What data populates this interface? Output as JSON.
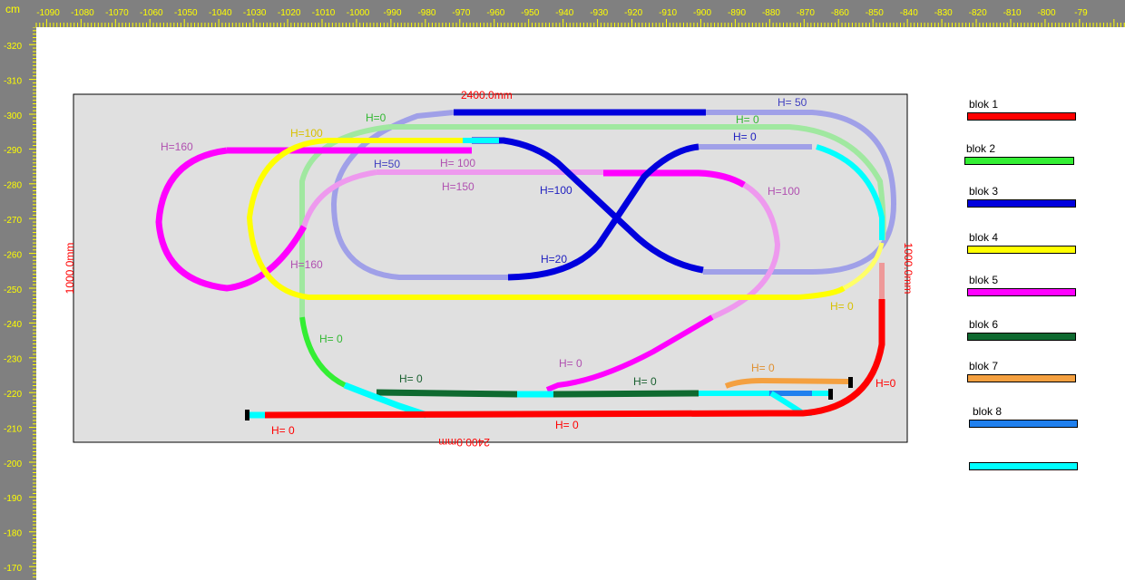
{
  "ruler": {
    "unit_label": "cm",
    "top_labels": [
      "-1090",
      "-1080",
      "-1070",
      "-1060",
      "-1050",
      "-1040",
      "-1030",
      "-1020",
      "-1010",
      "-1000",
      "-990",
      "-980",
      "-970",
      "-960",
      "-950",
      "-940",
      "-930",
      "-920",
      "-910",
      "-900",
      "-890",
      "-880",
      "-870",
      "-860",
      "-850",
      "-840",
      "-830",
      "-820",
      "-810",
      "-800",
      "-79"
    ],
    "left_labels": [
      "-320",
      "-310",
      "-300",
      "-290",
      "-280",
      "-270",
      "-260",
      "-250",
      "-240",
      "-230",
      "-220",
      "-210",
      "-200",
      "-190",
      "-180",
      "-170"
    ],
    "label_color": "#ffff00",
    "background": "#808080"
  },
  "board": {
    "width_label": "2400.0mm",
    "height_label": "1000.0mm",
    "background": "#e0e0e0",
    "dimension_color": "#ff0000"
  },
  "height_labels": [
    {
      "text": "H=0",
      "color": "#33b833"
    },
    {
      "text": "H=100",
      "color": "#d8c000"
    },
    {
      "text": "H=160",
      "color": "#b050b0"
    },
    {
      "text": "H=50",
      "color": "#4040c0"
    },
    {
      "text": "H= 100",
      "color": "#b050b0"
    },
    {
      "text": "H=150",
      "color": "#b050b0"
    },
    {
      "text": "H=100",
      "color": "#2020c0"
    },
    {
      "text": "H= 50",
      "color": "#4040c0"
    },
    {
      "text": "H= 0",
      "color": "#33b833"
    },
    {
      "text": "H= 0",
      "color": "#2020c0"
    },
    {
      "text": "H=100",
      "color": "#b050b0"
    },
    {
      "text": "H=20",
      "color": "#2020c0"
    },
    {
      "text": "H=160",
      "color": "#b050b0"
    },
    {
      "text": "H= 0",
      "color": "#d8c000"
    },
    {
      "text": "H= 0",
      "color": "#33b833"
    },
    {
      "text": "H= 0",
      "color": "#b050b0"
    },
    {
      "text": "H= 0",
      "color": "#1a6030"
    },
    {
      "text": "H= 0",
      "color": "#1a6030"
    },
    {
      "text": "H= 0",
      "color": "#e09030"
    },
    {
      "text": "H=0",
      "color": "#ff0000"
    },
    {
      "text": "H= 0",
      "color": "#ff0000"
    },
    {
      "text": "H= 0",
      "color": "#ff0000"
    }
  ],
  "legend": [
    {
      "label": "blok 1",
      "color": "#ff0000"
    },
    {
      "label": "blok 2",
      "color": "#33ee33"
    },
    {
      "label": "blok 3",
      "color": "#0000dd"
    },
    {
      "label": "blok 4",
      "color": "#ffff00"
    },
    {
      "label": "blok 5",
      "color": "#ff00ff"
    },
    {
      "label": "blok 6",
      "color": "#0f6a30"
    },
    {
      "label": "blok 7",
      "color": "#f4a040"
    },
    {
      "label": "blok 8",
      "color": "#2080ee"
    },
    {
      "label": "",
      "color": "#00ffff"
    }
  ],
  "track_colors": {
    "light_blue": "#a0a0e8",
    "light_green": "#a0e8a0",
    "light_magenta": "#ee99ee",
    "cyan": "#00ffff",
    "pink": "#ee9999",
    "light_yellow": "#ffff66"
  }
}
